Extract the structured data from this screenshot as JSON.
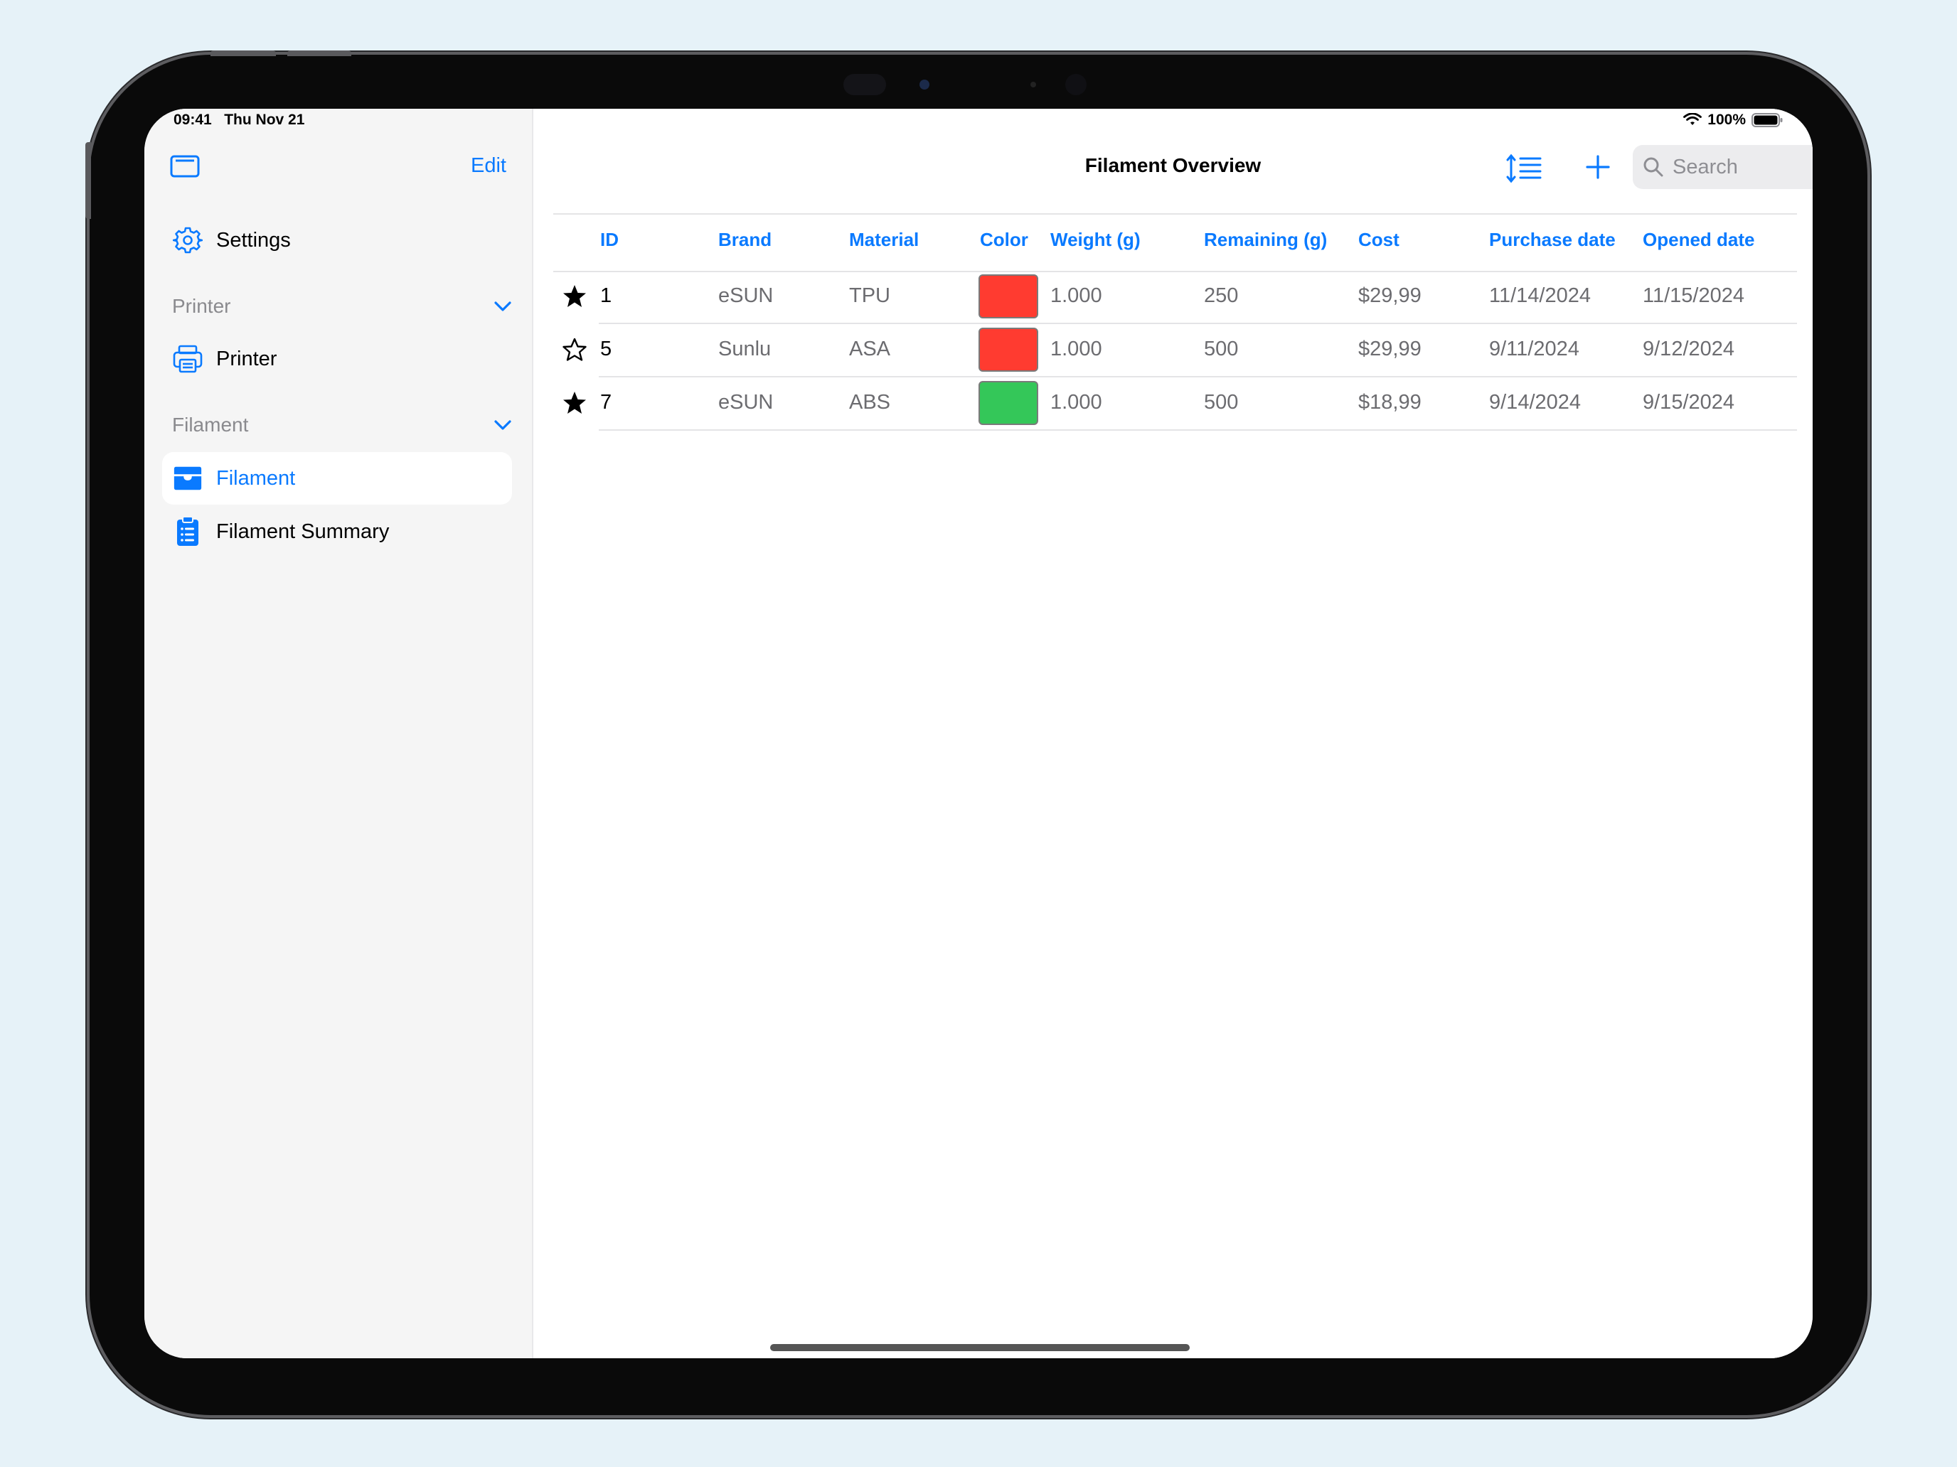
{
  "status_bar": {
    "time": "09:41",
    "date": "Thu Nov 21",
    "battery": "100%"
  },
  "sidebar": {
    "edit_label": "Edit",
    "settings_label": "Settings",
    "sections": [
      {
        "title": "Printer",
        "items": [
          {
            "label": "Printer",
            "icon": "printer-icon"
          }
        ]
      },
      {
        "title": "Filament",
        "items": [
          {
            "label": "Filament",
            "icon": "tray-icon",
            "selected": true
          },
          {
            "label": "Filament Summary",
            "icon": "clipboard-icon"
          }
        ]
      }
    ]
  },
  "toolbar": {
    "title": "Filament Overview",
    "search_placeholder": "Search"
  },
  "table": {
    "columns": [
      "ID",
      "Brand",
      "Material",
      "Color",
      "Weight (g)",
      "Remaining (g)",
      "Cost",
      "Purchase date",
      "Opened date"
    ],
    "rows": [
      {
        "favorite": true,
        "id": "1",
        "brand": "eSUN",
        "material": "TPU",
        "color": "#ff3b30",
        "weight": "1.000",
        "remaining": "250",
        "cost": "$29,99",
        "purchase_date": "11/14/2024",
        "opened_date": "11/15/2024"
      },
      {
        "favorite": false,
        "id": "5",
        "brand": "Sunlu",
        "material": "ASA",
        "color": "#ff3b30",
        "weight": "1.000",
        "remaining": "500",
        "cost": "$29,99",
        "purchase_date": "9/11/2024",
        "opened_date": "9/12/2024"
      },
      {
        "favorite": true,
        "id": "7",
        "brand": "eSUN",
        "material": "ABS",
        "color": "#34c759",
        "weight": "1.000",
        "remaining": "500",
        "cost": "$18,99",
        "purchase_date": "9/14/2024",
        "opened_date": "9/15/2024"
      }
    ]
  },
  "colors": {
    "accent": "#0a7aff",
    "sidebar_bg": "#f5f5f5"
  }
}
